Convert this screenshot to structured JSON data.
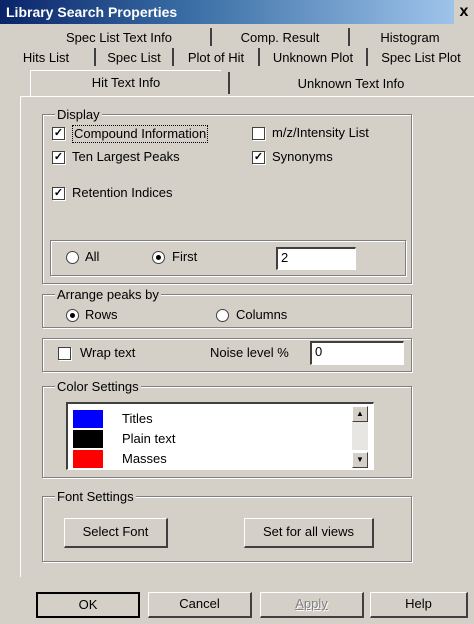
{
  "window": {
    "title": "Library Search Properties",
    "close_glyph": "x"
  },
  "tabs": {
    "row1": [
      "Spec List Text Info",
      "Comp. Result",
      "Histogram"
    ],
    "row2": [
      "Hits List",
      "Spec List",
      "Plot of Hit",
      "Unknown Plot",
      "Spec List Plot"
    ],
    "row3": [
      "Hit Text Info",
      "Unknown Text Info"
    ]
  },
  "display": {
    "label": "Display",
    "compound_information": "Compound Information",
    "mz_intensity_list": "m/z/Intensity List",
    "ten_largest_peaks": "Ten Largest Peaks",
    "synonyms": "Synonyms",
    "retention_indices": "Retention Indices",
    "all_label": "All",
    "first_label": "First",
    "first_value": "2",
    "check_glyph": "✓"
  },
  "arrange": {
    "label": "Arrange peaks by",
    "rows": "Rows",
    "columns": "Columns"
  },
  "wrap": {
    "wrap_text": "Wrap text",
    "noise_label": "Noise level %",
    "noise_value": "0"
  },
  "colors": {
    "label": "Color Settings",
    "items": [
      {
        "name": "Titles",
        "color": "#0000ff"
      },
      {
        "name": "Plain text",
        "color": "#000000"
      },
      {
        "name": "Masses",
        "color": "#ff0000"
      }
    ]
  },
  "font": {
    "label": "Font Settings",
    "select_font": "Select Font",
    "set_all": "Set for all views"
  },
  "buttons": {
    "ok": "OK",
    "cancel": "Cancel",
    "apply": "Apply",
    "help": "Help"
  }
}
